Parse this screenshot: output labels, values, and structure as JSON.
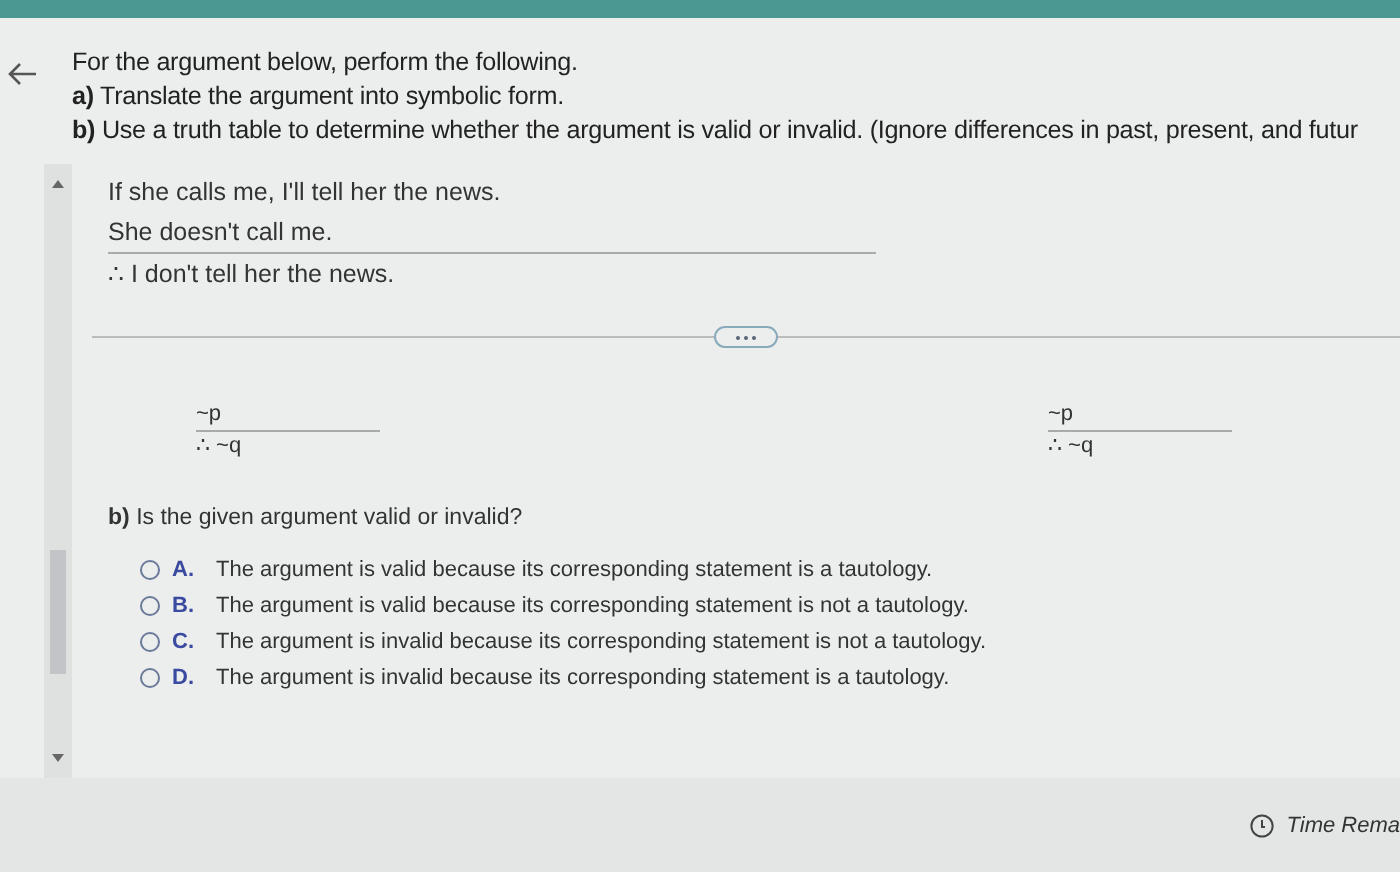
{
  "instructions": {
    "intro": "For the argument below, perform the following.",
    "parts": [
      {
        "label": "a)",
        "text": "Translate the argument into symbolic form."
      },
      {
        "label": "b)",
        "text": "Use a truth table to determine whether the argument is valid or invalid. (Ignore differences in past, present, and futur"
      }
    ]
  },
  "argument": {
    "premises": [
      "If she calls me, I'll tell her the news.",
      "She doesn't call me."
    ],
    "conclusion": "∴ I don't tell her the news."
  },
  "symbolic_forms": [
    {
      "premise": "~p",
      "conclusion": "∴ ~q"
    },
    {
      "premise": "~p",
      "conclusion": "∴ ~q"
    }
  ],
  "question": {
    "label": "b)",
    "text": "Is the given argument valid or invalid?"
  },
  "choices": [
    {
      "letter": "A.",
      "text": "The argument is valid because its corresponding statement is a tautology.",
      "selected": false
    },
    {
      "letter": "B.",
      "text": "The argument is valid because its corresponding statement is not a tautology.",
      "selected": false
    },
    {
      "letter": "C.",
      "text": "The argument is invalid because its corresponding statement is not a tautology.",
      "selected": false
    },
    {
      "letter": "D.",
      "text": "The argument is invalid because its corresponding statement is a tautology.",
      "selected": false
    }
  ],
  "footer": {
    "timer": "Time Rema"
  }
}
